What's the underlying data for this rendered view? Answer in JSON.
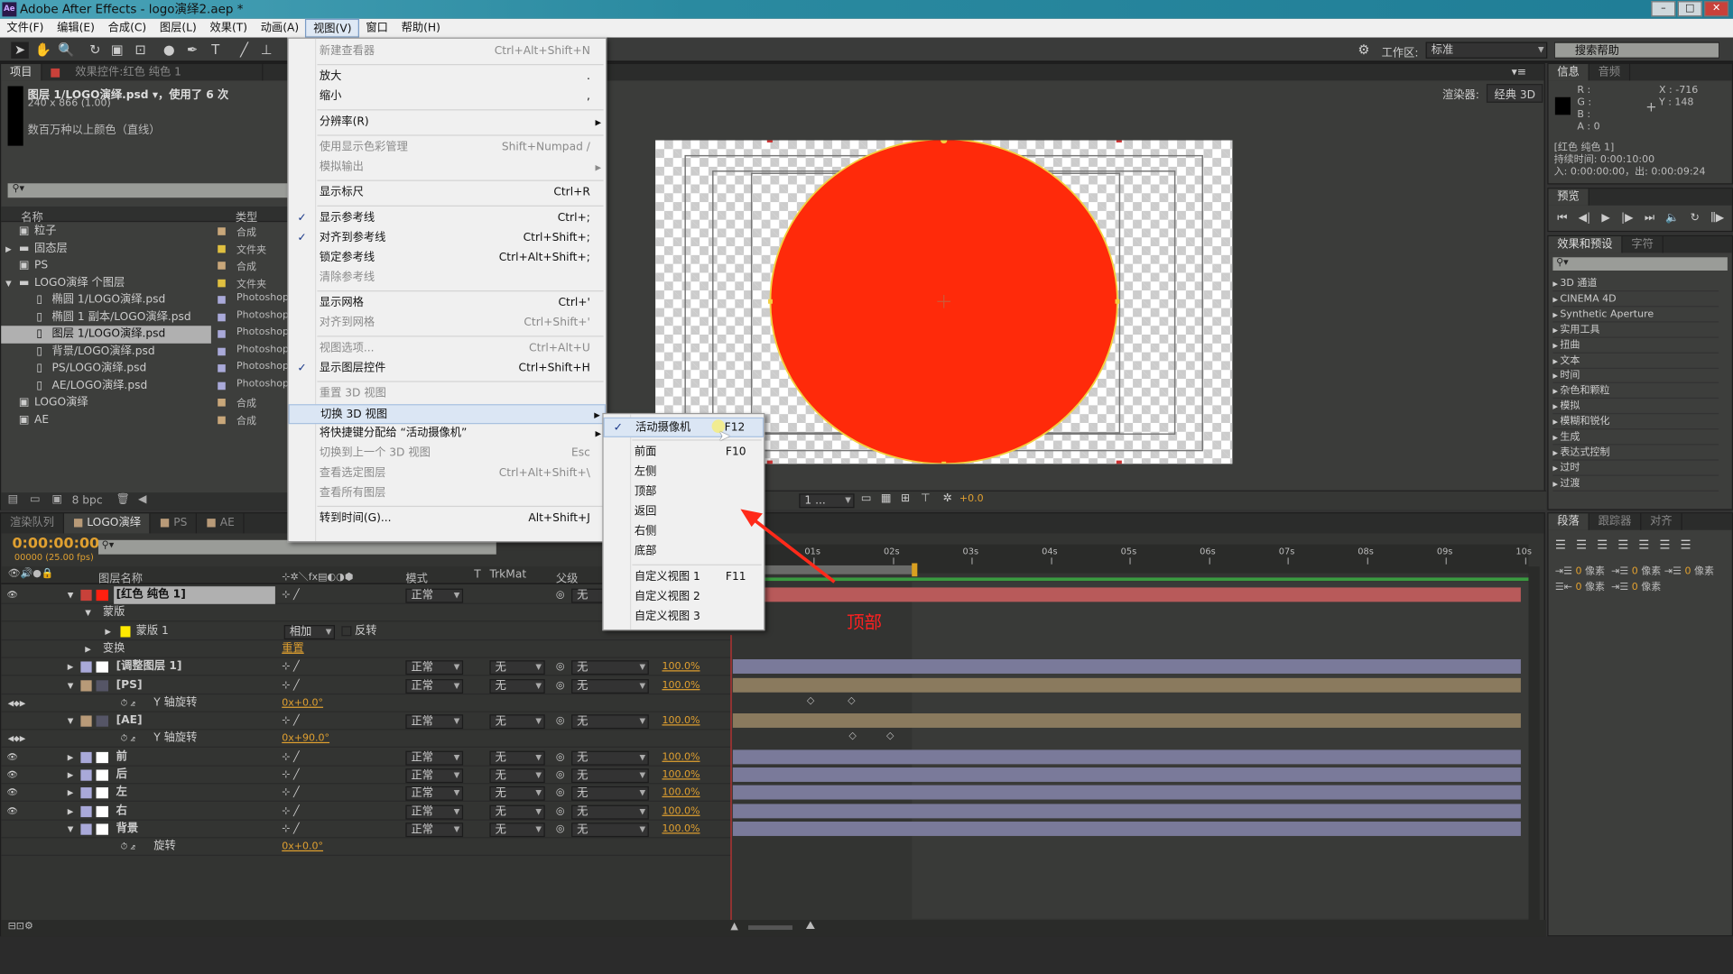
{
  "window": {
    "title": "Adobe After Effects - logo演绎2.aep *",
    "app_icon": "Ae"
  },
  "menubar": [
    "文件(F)",
    "编辑(E)",
    "合成(C)",
    "图层(L)",
    "效果(T)",
    "动画(A)",
    "视图(V)",
    "窗口",
    "帮助(H)"
  ],
  "toolbar": {
    "workspace_label": "工作区:",
    "workspace_value": "标准",
    "search_help": "搜索帮助"
  },
  "project": {
    "tabs": [
      "项目",
      "效果控件:红色 纯色 1"
    ],
    "selected_name": "图层 1/LOGO演绎.psd ▾，使用了 6 次",
    "selected_size": "240 x 866 (1.00)",
    "selected_info": "数百万种以上颜色（直线）",
    "col_name": "名称",
    "col_type": "类型",
    "items": [
      {
        "name": "粒子",
        "type": "合成",
        "icon": "comp",
        "indent": 0,
        "color": "#c9a77a"
      },
      {
        "name": "固态层",
        "type": "文件夹",
        "icon": "folder",
        "indent": 0,
        "color": "#e0c040",
        "arrow": "▶"
      },
      {
        "name": "PS",
        "type": "合成",
        "icon": "comp",
        "indent": 0,
        "color": "#c9a77a"
      },
      {
        "name": "LOGO演绎 个图层",
        "type": "文件夹",
        "icon": "folder",
        "indent": 0,
        "color": "#e0c040",
        "arrow": "▼"
      },
      {
        "name": "椭圆 1/LOGO演绎.psd",
        "type": "Photoshop",
        "icon": "file",
        "indent": 1,
        "color": "#a9a9d9"
      },
      {
        "name": "椭圆 1 副本/LOGO演绎.psd",
        "type": "Photoshop",
        "icon": "file",
        "indent": 1,
        "color": "#a9a9d9"
      },
      {
        "name": "图层 1/LOGO演绎.psd",
        "type": "Photoshop",
        "icon": "file",
        "indent": 1,
        "color": "#a9a9d9",
        "selected": true
      },
      {
        "name": "背景/LOGO演绎.psd",
        "type": "Photoshop",
        "icon": "file",
        "indent": 1,
        "color": "#a9a9d9"
      },
      {
        "name": "PS/LOGO演绎.psd",
        "type": "Photoshop",
        "icon": "file",
        "indent": 1,
        "color": "#a9a9d9"
      },
      {
        "name": "AE/LOGO演绎.psd",
        "type": "Photoshop",
        "icon": "file",
        "indent": 1,
        "color": "#a9a9d9"
      },
      {
        "name": "LOGO演绎",
        "type": "合成",
        "icon": "comp",
        "indent": 0,
        "color": "#c9a77a"
      },
      {
        "name": "AE",
        "type": "合成",
        "icon": "comp",
        "indent": 0,
        "color": "#c9a77a"
      }
    ],
    "bpc": "8 bpc"
  },
  "viewer": {
    "renderer_label": "渲染器:",
    "renderer_value": "经典 3D",
    "res_value": "1 ...",
    "exposure": "+0.0",
    "circle_color": "#ff2a0a"
  },
  "view_menu": [
    {
      "label": "新建查看器",
      "shortcut": "Ctrl+Alt+Shift+N",
      "disabled": true
    },
    {
      "sep": true
    },
    {
      "label": "放大",
      "shortcut": "."
    },
    {
      "label": "缩小",
      "shortcut": ","
    },
    {
      "sep": true
    },
    {
      "label": "分辨率(R)",
      "submenu": true
    },
    {
      "sep": true
    },
    {
      "label": "使用显示色彩管理",
      "shortcut": "Shift+Numpad /",
      "disabled": true
    },
    {
      "label": "模拟输出",
      "submenu": true,
      "disabled": true
    },
    {
      "sep": true
    },
    {
      "label": "显示标尺",
      "shortcut": "Ctrl+R"
    },
    {
      "sep": true
    },
    {
      "label": "显示参考线",
      "shortcut": "Ctrl+;",
      "checked": true
    },
    {
      "label": "对齐到参考线",
      "shortcut": "Ctrl+Shift+;",
      "checked": true
    },
    {
      "label": "锁定参考线",
      "shortcut": "Ctrl+Alt+Shift+;"
    },
    {
      "label": "清除参考线",
      "disabled": true
    },
    {
      "sep": true
    },
    {
      "label": "显示网格",
      "shortcut": "Ctrl+'"
    },
    {
      "label": "对齐到网格",
      "shortcut": "Ctrl+Shift+'",
      "disabled": true
    },
    {
      "sep": true
    },
    {
      "label": "视图选项...",
      "shortcut": "Ctrl+Alt+U",
      "disabled": true
    },
    {
      "label": "显示图层控件",
      "shortcut": "Ctrl+Shift+H",
      "checked": true
    },
    {
      "sep": true
    },
    {
      "label": "重置 3D 视图",
      "disabled": true
    },
    {
      "label": "切换 3D 视图",
      "submenu": true,
      "highlighted": true
    },
    {
      "label": "将快捷键分配给 “活动摄像机”",
      "submenu": true
    },
    {
      "label": "切换到上一个 3D 视图",
      "shortcut": "Esc",
      "disabled": true
    },
    {
      "label": "查看选定图层",
      "shortcut": "Ctrl+Alt+Shift+\\",
      "disabled": true
    },
    {
      "label": "查看所有图层",
      "disabled": true
    },
    {
      "sep": true
    },
    {
      "label": "转到时间(G)...",
      "shortcut": "Alt+Shift+J"
    }
  ],
  "view3d_submenu": [
    {
      "label": "活动摄像机",
      "shortcut": "F12",
      "checked": true,
      "highlighted": true
    },
    {
      "sep": true
    },
    {
      "label": "前面",
      "shortcut": "F10"
    },
    {
      "label": "左侧"
    },
    {
      "label": "顶部"
    },
    {
      "label": "返回"
    },
    {
      "label": "右侧"
    },
    {
      "label": "底部"
    },
    {
      "sep": true
    },
    {
      "label": "自定义视图 1",
      "shortcut": "F11"
    },
    {
      "label": "自定义视图 2"
    },
    {
      "label": "自定义视图 3"
    }
  ],
  "annotation": {
    "text": "顶部",
    "color": "#ff2020"
  },
  "info": {
    "tabs": [
      "信息",
      "音频"
    ],
    "r": "R :",
    "g": "G :",
    "b": "B :",
    "a": "A : 0",
    "x": "X : -716",
    "y": "Y : 148",
    "layer": "[红色 纯色 1]",
    "duration": "持续时间: 0:00:10:00",
    "inout": "入: 0:00:00:00，出: 0:00:09:24"
  },
  "preview": {
    "tab": "预览"
  },
  "effects": {
    "tabs": [
      "效果和预设",
      "字符"
    ],
    "items": [
      "3D 通道",
      "CINEMA 4D",
      "Synthetic Aperture",
      "实用工具",
      "扭曲",
      "文本",
      "时间",
      "杂色和颗粒",
      "模拟",
      "模糊和锐化",
      "生成",
      "表达式控制",
      "过时",
      "过渡"
    ]
  },
  "paragraph": {
    "tabs": [
      "段落",
      "跟踪器",
      "对齐"
    ],
    "indent_value": "0",
    "unit": "像素"
  },
  "timeline": {
    "tabs": [
      "渲染队列",
      "LOGO演绎",
      "PS",
      "AE"
    ],
    "timecode": "0:00:00:00",
    "fps": "00000 (25.00 fps)",
    "headers": {
      "name": "图层名称",
      "mode": "模式",
      "t": "T",
      "trkmat": "TrkMat",
      "parent": "父级"
    },
    "ruler": [
      "01s",
      "02s",
      "03s",
      "04s",
      "05s",
      "06s",
      "07s",
      "08s",
      "09s",
      "10s"
    ],
    "rows": [
      {
        "kind": "layer",
        "name": "[红色 纯色 1]",
        "label": "#c8413a",
        "swatch": "#ff2010",
        "mode": "正常",
        "trk": "",
        "parent": "无",
        "selected": true,
        "eye": true,
        "open": true,
        "bar": "#b85a5a"
      },
      {
        "kind": "group",
        "name": "蒙版",
        "indent": 1,
        "open": true
      },
      {
        "kind": "mask",
        "name": "蒙版 1",
        "indent": 2,
        "mask_mode": "相加",
        "invert": "反转"
      },
      {
        "kind": "group",
        "name": "变换",
        "indent": 1,
        "value": "重置"
      },
      {
        "kind": "layer",
        "name": "[调整图层 1]",
        "label": "#a9a9d9",
        "swatch": "#ffffff",
        "mode": "正常",
        "trk": "无",
        "parent": "无",
        "stretch": "100.0%",
        "bar": "#7a7a9a"
      },
      {
        "kind": "layer",
        "name": "[PS]",
        "label": "#b89a78",
        "swatch": "comp",
        "mode": "正常",
        "trk": "无",
        "parent": "无",
        "stretch": "100.0%",
        "open": true,
        "bar": "#8a7a5e"
      },
      {
        "kind": "prop",
        "name": "Y 轴旋转",
        "value": "0x+0.0°"
      },
      {
        "kind": "layer",
        "name": "[AE]",
        "label": "#b89a78",
        "swatch": "comp",
        "mode": "正常",
        "trk": "无",
        "parent": "无",
        "stretch": "100.0%",
        "open": true,
        "bar": "#8a7a5e"
      },
      {
        "kind": "prop",
        "name": "Y 轴旋转",
        "value": "0x+90.0°"
      },
      {
        "kind": "layer",
        "name": "前",
        "label": "#a9a9d9",
        "swatch": "#ffffff",
        "mode": "正常",
        "trk": "无",
        "parent": "无",
        "stretch": "100.0%",
        "eye": true,
        "bar": "#7a7a9a"
      },
      {
        "kind": "layer",
        "name": "后",
        "label": "#a9a9d9",
        "swatch": "#ffffff",
        "mode": "正常",
        "trk": "无",
        "parent": "无",
        "stretch": "100.0%",
        "eye": true,
        "bar": "#7a7a9a"
      },
      {
        "kind": "layer",
        "name": "左",
        "label": "#a9a9d9",
        "swatch": "#ffffff",
        "mode": "正常",
        "trk": "无",
        "parent": "无",
        "stretch": "100.0%",
        "eye": true,
        "bar": "#7a7a9a"
      },
      {
        "kind": "layer",
        "name": "右",
        "label": "#a9a9d9",
        "swatch": "#ffffff",
        "mode": "正常",
        "trk": "无",
        "parent": "无",
        "stretch": "100.0%",
        "eye": true,
        "bar": "#7a7a9a"
      },
      {
        "kind": "layer",
        "name": "背景",
        "label": "#a9a9d9",
        "swatch": "#ffffff",
        "mode": "正常",
        "trk": "无",
        "parent": "无",
        "stretch": "100.0%",
        "open": true,
        "bar": "#7a7a9a"
      },
      {
        "kind": "prop",
        "name": "旋转",
        "value": "0x+0.0°"
      }
    ]
  }
}
